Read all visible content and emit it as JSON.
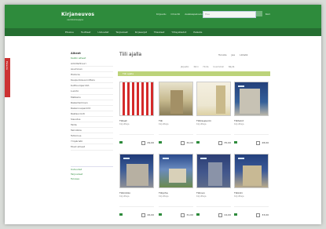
{
  "header": {
    "logo": "Kirjaneuvos",
    "logo_sub": "verkkokauppa",
    "top_links": [
      "Kirjaudu",
      "Oma tili",
      "Asiakaspalvelu"
    ],
    "search_placeholder": "Hae",
    "cart": "Kori"
  },
  "nav": {
    "items": [
      "Etusivu",
      "Tuotteet",
      "Uutuudet",
      "Tarjoukset",
      "Kirjasarjat",
      "Tilaukset",
      "Yhteystiedot",
      "Palaute"
    ]
  },
  "side_tab": "Palaute",
  "sidebar": {
    "title": "Aiheet",
    "selected": "Kaikki aiheet",
    "items": [
      "Arkkitehtuuri",
      "Asuminen",
      "Historia",
      "Kaupunkisuunnittelu",
      "Kulttuuriperintö",
      "Luonto",
      "Matkailu",
      "Rakentaminen",
      "Rakennusperintö",
      "Restaurointi",
      "Sisustus",
      "Taide",
      "Tekniikka",
      "Tutkimus",
      "Ympäristö",
      "Muut aiheet"
    ],
    "box": [
      "Uutuudet",
      "Tarjoukset",
      "Tulossa"
    ]
  },
  "main": {
    "title": "Tiili ajalla",
    "tools": [
      "Tulosta",
      "Jaa",
      "Lähetä"
    ],
    "sort": [
      "Järjestä:",
      "Nimi",
      "Hinta",
      "Uusimmat",
      "Näytä"
    ],
    "filter": "Tiili ajalla",
    "products": [
      {
        "title": "Tiiliset",
        "author": "Kirjoittaja",
        "price": "29,00"
      },
      {
        "title": "Tiili",
        "author": "Kirjoittaja",
        "price": "32,00"
      },
      {
        "title": "Tiilikaupunki",
        "author": "Kirjoittaja",
        "price": "35,00"
      },
      {
        "title": "Tiilitalot",
        "author": "Kirjoittaja",
        "price": "28,00"
      },
      {
        "title": "Tiilikirkko",
        "author": "Kirjoittaja",
        "price": "26,00"
      },
      {
        "title": "Tiilipiha",
        "author": "Kirjoittaja",
        "price": "31,00"
      },
      {
        "title": "Tiilinen",
        "author": "Kirjoittaja",
        "price": "24,00"
      },
      {
        "title": "Tiilikoti",
        "author": "Kirjoittaja",
        "price": "33,00"
      }
    ]
  },
  "colors": {
    "header": "#2e8b3c",
    "nav": "#256e31",
    "filter": "#bcd37a",
    "side_tab": "#cc3232"
  }
}
